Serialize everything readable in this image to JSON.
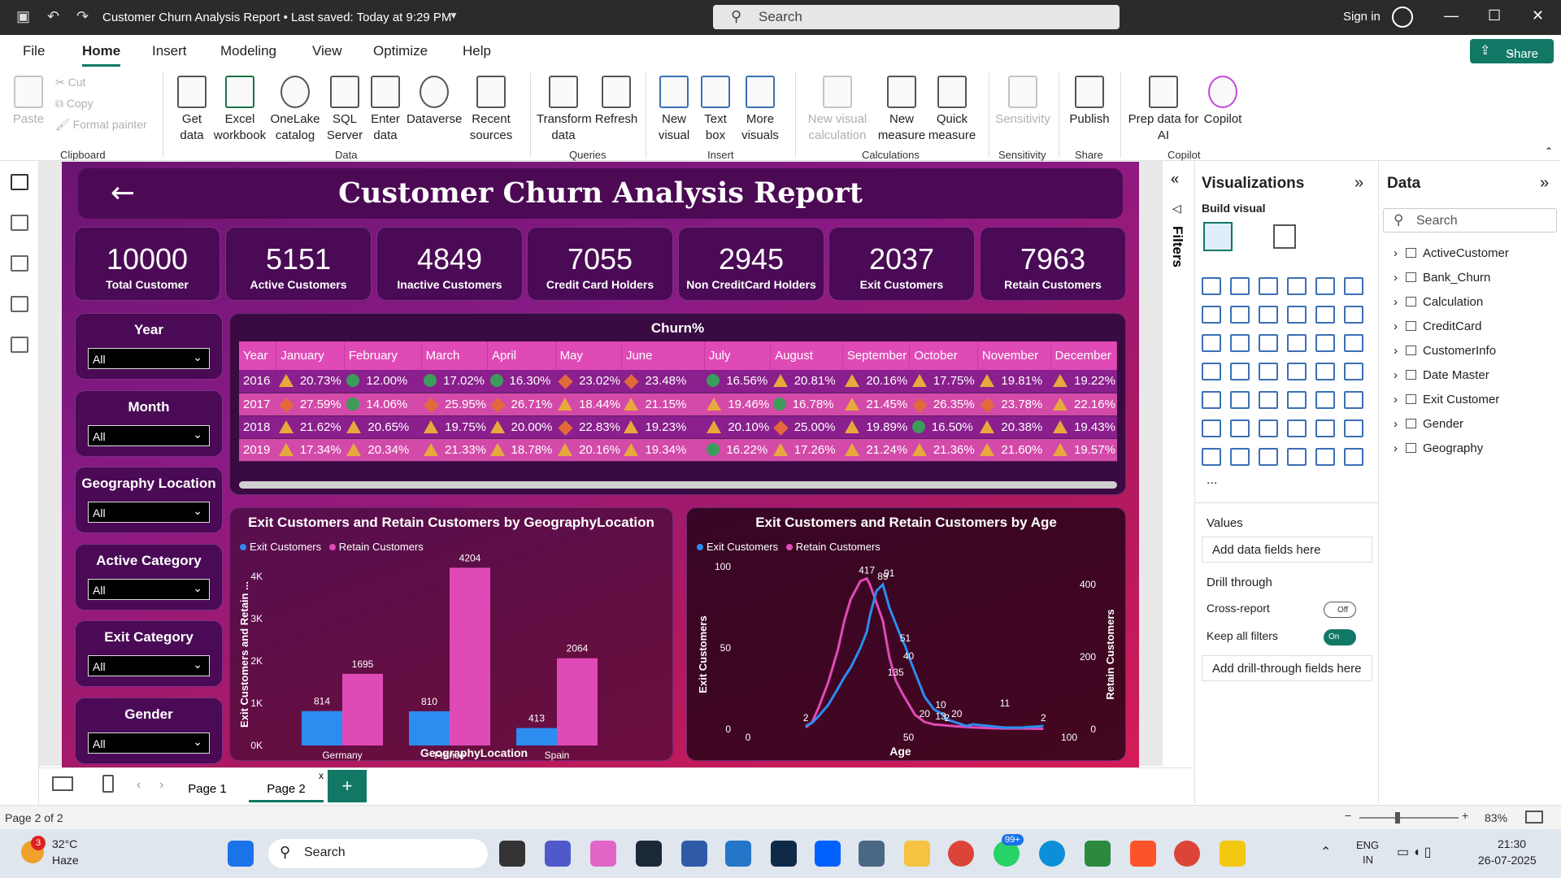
{
  "window": {
    "title": "Customer Churn Analysis Report • Last saved: Today at 9:29 PM",
    "search_placeholder": "Search",
    "signin": "Sign in"
  },
  "menu": {
    "items": [
      "File",
      "Home",
      "Insert",
      "Modeling",
      "View",
      "Optimize",
      "Help"
    ],
    "active": "Home",
    "share": "Share"
  },
  "ribbon": {
    "clipboard": {
      "paste": "Paste",
      "cut": "Cut",
      "copy": "Copy",
      "format_painter": "Format painter",
      "group": "Clipboard"
    },
    "data": {
      "get_data": "Get data",
      "excel": "Excel workbook",
      "onelake": "OneLake catalog",
      "sql": "SQL Server",
      "enter": "Enter data",
      "dataverse": "Dataverse",
      "recent": "Recent sources",
      "group": "Data"
    },
    "queries": {
      "transform": "Transform data",
      "refresh": "Refresh",
      "group": "Queries"
    },
    "insert": {
      "new_visual": "New visual",
      "text_box": "Text box",
      "more_visuals": "More visuals",
      "group": "Insert"
    },
    "calculations": {
      "new_visual_calc": "New visual calculation",
      "new_measure": "New measure",
      "quick_measure": "Quick measure",
      "group": "Calculations"
    },
    "sensitivity": {
      "label": "Sensitivity",
      "group": "Sensitivity"
    },
    "share": {
      "publish": "Publish",
      "group": "Share"
    },
    "copilot": {
      "prep": "Prep data for AI",
      "copilot": "Copilot",
      "group": "Copilot"
    }
  },
  "report": {
    "title": "Customer Churn Analysis Report",
    "kpis": [
      {
        "value": "10000",
        "label": "Total Customer"
      },
      {
        "value": "5151",
        "label": "Active Customers"
      },
      {
        "value": "4849",
        "label": "Inactive Customers"
      },
      {
        "value": "7055",
        "label": "Credit Card Holders"
      },
      {
        "value": "2945",
        "label": "Non CreditCard Holders"
      },
      {
        "value": "2037",
        "label": "Exit Customers"
      },
      {
        "value": "7963",
        "label": "Retain Customers"
      }
    ],
    "slicers": [
      {
        "title": "Year",
        "value": "All"
      },
      {
        "title": "Month",
        "value": "All"
      },
      {
        "title": "Geography Location",
        "value": "All"
      },
      {
        "title": "Active Category",
        "value": "All"
      },
      {
        "title": "Exit Category",
        "value": "All"
      },
      {
        "title": "Gender",
        "value": "All"
      }
    ],
    "matrix": {
      "title": "Churn%",
      "columns": [
        "Year",
        "January",
        "February",
        "March",
        "April",
        "May",
        "June",
        "July",
        "August",
        "September",
        "October",
        "November",
        "December"
      ],
      "rows": [
        {
          "year": "2016",
          "cells": [
            [
              "tri",
              "20.73%"
            ],
            [
              "cir",
              "12.00%"
            ],
            [
              "cir",
              "17.02%"
            ],
            [
              "cir",
              "16.30%"
            ],
            [
              "dia",
              "23.02%"
            ],
            [
              "dia",
              "23.48%"
            ],
            [
              "cir",
              "16.56%"
            ],
            [
              "tri",
              "20.81%"
            ],
            [
              "tri",
              "20.16%"
            ],
            [
              "tri",
              "17.75%"
            ],
            [
              "tri",
              "19.81%"
            ],
            [
              "tri",
              "19.22%"
            ]
          ]
        },
        {
          "year": "2017",
          "cells": [
            [
              "dia",
              "27.59%"
            ],
            [
              "cir",
              "14.06%"
            ],
            [
              "dia",
              "25.95%"
            ],
            [
              "dia",
              "26.71%"
            ],
            [
              "tri",
              "18.44%"
            ],
            [
              "tri",
              "21.15%"
            ],
            [
              "tri",
              "19.46%"
            ],
            [
              "cir",
              "16.78%"
            ],
            [
              "tri",
              "21.45%"
            ],
            [
              "dia",
              "26.35%"
            ],
            [
              "dia",
              "23.78%"
            ],
            [
              "tri",
              "22.16%"
            ]
          ]
        },
        {
          "year": "2018",
          "cells": [
            [
              "tri",
              "21.62%"
            ],
            [
              "tri",
              "20.65%"
            ],
            [
              "tri",
              "19.75%"
            ],
            [
              "tri",
              "20.00%"
            ],
            [
              "dia",
              "22.83%"
            ],
            [
              "tri",
              "19.23%"
            ],
            [
              "tri",
              "20.10%"
            ],
            [
              "dia",
              "25.00%"
            ],
            [
              "tri",
              "19.89%"
            ],
            [
              "cir",
              "16.50%"
            ],
            [
              "tri",
              "20.38%"
            ],
            [
              "tri",
              "19.43%"
            ]
          ]
        },
        {
          "year": "2019",
          "cells": [
            [
              "tri",
              "17.34%"
            ],
            [
              "tri",
              "20.34%"
            ],
            [
              "tri",
              "21.33%"
            ],
            [
              "tri",
              "18.78%"
            ],
            [
              "tri",
              "20.16%"
            ],
            [
              "tri",
              "19.34%"
            ],
            [
              "cir",
              "16.22%"
            ],
            [
              "tri",
              "17.26%"
            ],
            [
              "tri",
              "21.24%"
            ],
            [
              "tri",
              "21.36%"
            ],
            [
              "tri",
              "21.60%"
            ],
            [
              "tri",
              "19.57%"
            ]
          ]
        }
      ]
    }
  },
  "chart_data": [
    {
      "type": "bar",
      "title": "Exit Customers and Retain Customers by GeographyLocation",
      "xlabel": "GeographyLocation",
      "ylabel": "Exit Customers and Retain ...",
      "categories": [
        "Germany",
        "France",
        "Spain"
      ],
      "series": [
        {
          "name": "Exit Customers",
          "values": [
            814,
            810,
            413
          ],
          "color": "#2d8cf0"
        },
        {
          "name": "Retain Customers",
          "values": [
            1695,
            4204,
            2064
          ],
          "color": "#e04ab6"
        }
      ],
      "yticks": [
        "0K",
        "1K",
        "2K",
        "3K",
        "4K"
      ],
      "ylim": [
        0,
        4500
      ],
      "legend": "top-left"
    },
    {
      "type": "line",
      "title": "Exit Customers and Retain Customers by Age",
      "xlabel": "Age",
      "ylabel": "Exit Customers",
      "y2label": "Retain Customers",
      "xticks": [
        "0",
        "50",
        "100"
      ],
      "yticks": [
        "0",
        "50",
        "100"
      ],
      "y2ticks": [
        "0",
        "200",
        "400"
      ],
      "series": [
        {
          "name": "Exit Customers",
          "color": "#2d8cf0",
          "x": [
            18,
            20,
            22,
            25,
            28,
            30,
            32,
            35,
            37,
            38,
            40,
            42,
            44,
            46,
            48,
            49,
            50,
            52,
            55,
            58,
            60,
            62,
            65,
            68,
            70,
            75,
            80,
            85,
            92
          ],
          "y": [
            2,
            4,
            8,
            15,
            25,
            32,
            38,
            50,
            60,
            70,
            85,
            89,
            75,
            65,
            55,
            51,
            45,
            35,
            20,
            12,
            10,
            6,
            4,
            2,
            3,
            2,
            1,
            1,
            2
          ],
          "labels": [
            {
              "x": 18,
              "y": 2,
              "text": "2"
            },
            {
              "x": 42,
              "y": 89,
              "text": "89"
            },
            {
              "x": 44,
              "y": 91,
              "text": "91"
            },
            {
              "x": 49,
              "y": 51,
              "text": "51"
            },
            {
              "x": 50,
              "y": 40,
              "text": "40"
            },
            {
              "x": 60,
              "y": 10,
              "text": "10"
            },
            {
              "x": 62,
              "y": 2,
              "text": "2"
            },
            {
              "x": 80,
              "y": 11,
              "text": "11"
            },
            {
              "x": 92,
              "y": 2,
              "text": "2"
            }
          ]
        },
        {
          "name": "Retain Customers",
          "color": "#e04ab6",
          "x": [
            18,
            20,
            22,
            25,
            28,
            30,
            32,
            35,
            37,
            38,
            40,
            42,
            44,
            46,
            48,
            50,
            52,
            55,
            58,
            60,
            62,
            65,
            70,
            75,
            80,
            85,
            92
          ],
          "y2": [
            5,
            20,
            60,
            130,
            220,
            300,
            360,
            410,
            417,
            400,
            350,
            300,
            200,
            135,
            100,
            70,
            40,
            20,
            13,
            12,
            10,
            8,
            5,
            3,
            2,
            2,
            1
          ],
          "labels": [
            {
              "x": 37,
              "y2": 417,
              "text": "417"
            },
            {
              "x": 46,
              "y2": 135,
              "text": "135"
            },
            {
              "x": 55,
              "y2": 20,
              "text": "20"
            },
            {
              "x": 60,
              "y2": 13,
              "text": "13"
            },
            {
              "x": 65,
              "y2": 20,
              "text": "20"
            }
          ]
        }
      ],
      "xlim": [
        0,
        100
      ],
      "ylim": [
        0,
        100
      ],
      "y2lim": [
        0,
        450
      ],
      "legend": "top-left"
    }
  ],
  "filters": {
    "label": "Filters"
  },
  "visualizations": {
    "title": "Visualizations",
    "build": "Build visual",
    "values_label": "Values",
    "values_placeholder": "Add data fields here",
    "drill": "Drill through",
    "cross": "Cross-report",
    "cross_state": "Off",
    "keep": "Keep all filters",
    "keep_state": "On",
    "drill_placeholder": "Add drill-through fields here",
    "more": "..."
  },
  "data_pane": {
    "title": "Data",
    "search": "Search",
    "tables": [
      "ActiveCustomer",
      "Bank_Churn",
      "Calculation",
      "CreditCard",
      "CustomerInfo",
      "Date Master",
      "Exit Customer",
      "Gender",
      "Geography"
    ]
  },
  "pages": {
    "tabs": [
      "Page 1",
      "Page 2"
    ],
    "active": "Page 2",
    "add": "+"
  },
  "status": {
    "page": "Page 2 of 2",
    "zoom": "83%"
  },
  "taskbar": {
    "weather_temp": "32°C",
    "weather_desc": "Haze",
    "weather_badge": "3",
    "search": "Search",
    "lang1": "ENG",
    "lang2": "IN",
    "time": "21:30",
    "date": "26-07-2025",
    "whatsapp_badge": "99+"
  }
}
